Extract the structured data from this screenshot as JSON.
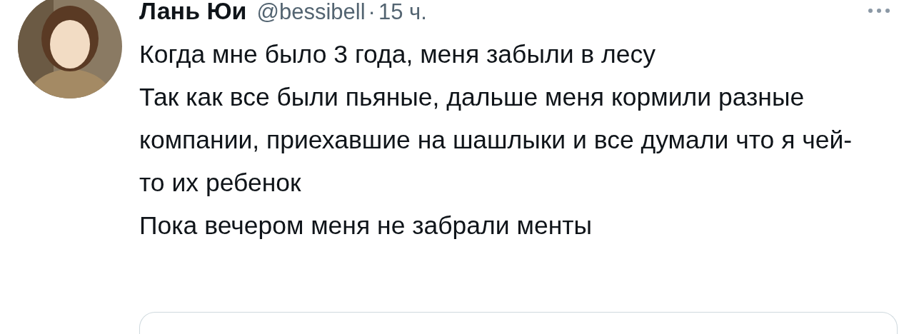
{
  "tweet": {
    "author": {
      "name": "Лань Юи",
      "handle": "@bessibell",
      "time": "15 ч.",
      "separator": "·"
    },
    "paragraphs": [
      "Когда мне было 3 года, меня забыли в лесу",
      "Так как все были пьяные, дальше меня кормили разные компании, приехавшие на шашлыки и все думали что я чей-то их ребенок",
      "Пока вечером меня не забрали менты"
    ]
  }
}
